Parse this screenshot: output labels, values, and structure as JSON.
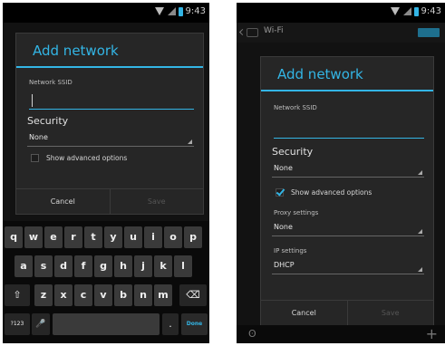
{
  "status": {
    "time": "9:43"
  },
  "left": {
    "dialog": {
      "title": "Add network",
      "ssid_label": "Network SSID",
      "security_label": "Security",
      "security_value": "None",
      "advanced_label": "Show advanced options",
      "cancel": "Cancel",
      "save": "Save"
    },
    "keyboard": {
      "row1": [
        "q",
        "w",
        "e",
        "r",
        "t",
        "y",
        "u",
        "i",
        "o",
        "p"
      ],
      "row2": [
        "a",
        "s",
        "d",
        "f",
        "g",
        "h",
        "j",
        "k",
        "l"
      ],
      "row3": [
        "z",
        "x",
        "c",
        "v",
        "b",
        "n",
        "m"
      ],
      "shift": "⇧",
      "delete": "⌫",
      "symbols": "?123",
      "mic": "🎤",
      "period": ".",
      "done": "Done"
    }
  },
  "right": {
    "actionbar": {
      "title": "Wi-Fi"
    },
    "dialog": {
      "title": "Add network",
      "ssid_label": "Network SSID",
      "security_label": "Security",
      "security_value": "None",
      "advanced_label": "Show advanced options",
      "proxy_label": "Proxy settings",
      "proxy_value": "None",
      "ip_label": "IP settings",
      "ip_value": "DHCP",
      "cancel": "Cancel",
      "save": "Save"
    },
    "bottom": {
      "wps": "ʘ",
      "add": "+"
    }
  },
  "colors": {
    "accent": "#33b5e5",
    "background": "#0d0d0d",
    "dialog": "#262626"
  }
}
